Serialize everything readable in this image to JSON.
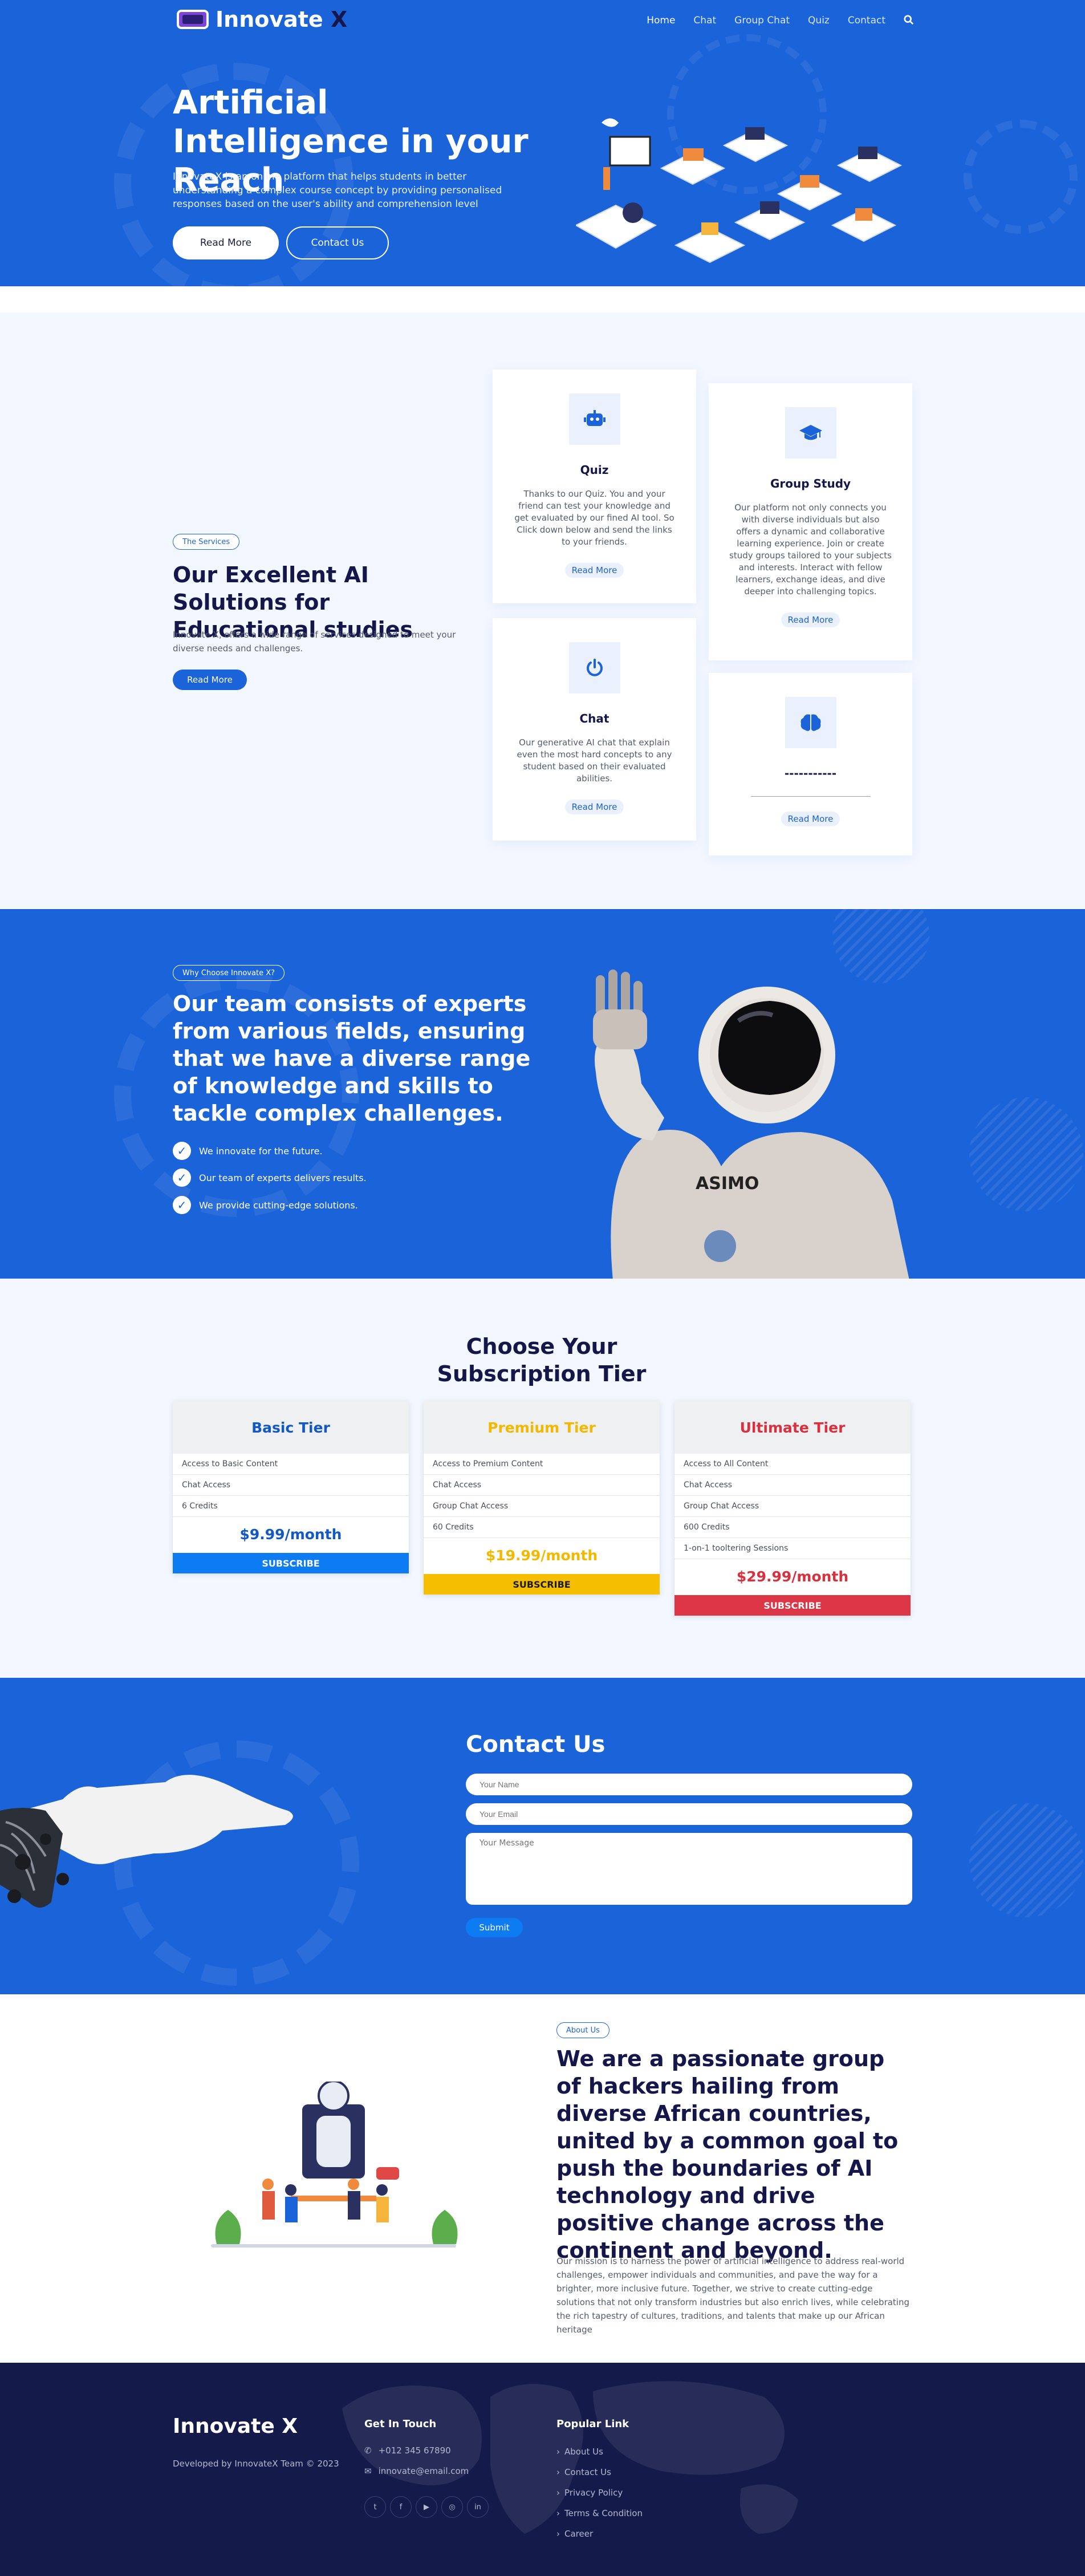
{
  "brand": {
    "name": "Innovate",
    "x": "X"
  },
  "nav": {
    "items": [
      "Home",
      "Chat",
      "Group Chat",
      "Quiz",
      "Contact"
    ],
    "active": "Home"
  },
  "hero": {
    "title": "Artificial Intelligence in your Reach",
    "text": "InnovateX is an online platform that helps students in better understanding a complex course concept by providing personalised responses based on the user's ability and comprehension level",
    "read_more": "Read More",
    "contact_us": "Contact Us"
  },
  "services": {
    "tag": "The Services",
    "title": "Our Excellent AI Solutions for Educational studies",
    "text": "Innovate X, offers a wide range of services designed to meet your diverse needs and challenges.",
    "button": "Read More",
    "cards": [
      {
        "icon": "robot-icon",
        "title": "Quiz",
        "text": "Thanks to our Quiz. You and your friend can test your knowledge and get evaluated by our fined AI tool. So Click down below and send the links to your friends.",
        "link": "Read More"
      },
      {
        "icon": "graduation-cap-icon",
        "title": "Group Study",
        "text": "Our platform not only connects you with diverse individuals but also offers a dynamic and collaborative learning experience. Join or create study groups tailored to your subjects and interests. Interact with fellow learners, exchange ideas, and dive deeper into challenging topics.",
        "link": "Read More"
      },
      {
        "icon": "power-icon",
        "title": "Chat",
        "text": "Our generative AI chat that explain even the most hard concepts to any student based on their evaluated abilities.",
        "link": "Read More"
      },
      {
        "icon": "brain-icon",
        "title": "-----------",
        "text": "",
        "link": "Read More"
      }
    ]
  },
  "why": {
    "tag": "Why Choose Innovate X?",
    "title": "Our team consists of experts from various fields, ensuring that we have a diverse range of knowledge and skills to tackle complex challenges.",
    "points": [
      "We innovate for the future.",
      "Our team of experts delivers results.",
      "We provide cutting-edge solutions."
    ],
    "robot_label": "ASIMO"
  },
  "pricing": {
    "title": "Choose Your Subscription Tier",
    "tiers": [
      {
        "name": "Basic Tier",
        "color": "#1259c3",
        "bar": "#0d7cf2",
        "items": [
          "Access to Basic Content",
          "Chat Access",
          "6 Credits"
        ],
        "price": "$9.99/month",
        "button": "SUBSCRIBE"
      },
      {
        "name": "Premium Tier",
        "color": "#f3b800",
        "bar": "#f5bf00",
        "items": [
          "Access to Premium Content",
          "Chat Access",
          "Group Chat Access",
          "60 Credits"
        ],
        "price": "$19.99/month",
        "button": "SUBSCRIBE"
      },
      {
        "name": "Ultimate Tier",
        "color": "#d9303e",
        "bar": "#dc3545",
        "items": [
          "Access to All Content",
          "Chat Access",
          "Group Chat Access",
          "600 Credits",
          "1-on-1 tooltering Sessions"
        ],
        "price": "$29.99/month",
        "button": "SUBSCRIBE"
      }
    ]
  },
  "contact": {
    "title": "Contact Us",
    "name_placeholder": "Your Name",
    "email_placeholder": "Your Email",
    "message_placeholder": "Your Message",
    "submit": "Submit"
  },
  "about": {
    "tag": "About Us",
    "title": "We are a passionate group of hackers hailing from diverse African countries, united by a common goal to push the boundaries of AI technology and drive positive change across the continent and beyond.",
    "text": "Our mission is to harness the power of artificial intelligence to address real-world challenges, empower individuals and communities, and pave the way for a brighter, more inclusive future. Together, we strive to create cutting-edge solutions that not only transform industries but also enrich lives, while celebrating the rich tapestry of cultures, traditions, and talents that make up our African heritage"
  },
  "footer": {
    "brand": "Innovate X",
    "credit": "Developed by InnovateX Team © 2023",
    "get_in_touch": "Get In Touch",
    "phone": "+012 345 67890",
    "email": "innovate@email.com",
    "social": [
      "twitter-icon",
      "facebook-icon",
      "youtube-icon",
      "instagram-icon",
      "linkedin-icon"
    ],
    "popular_link": "Popular Link",
    "links": [
      "About Us",
      "Contact Us",
      "Privacy Policy",
      "Terms & Condition",
      "Career"
    ]
  }
}
